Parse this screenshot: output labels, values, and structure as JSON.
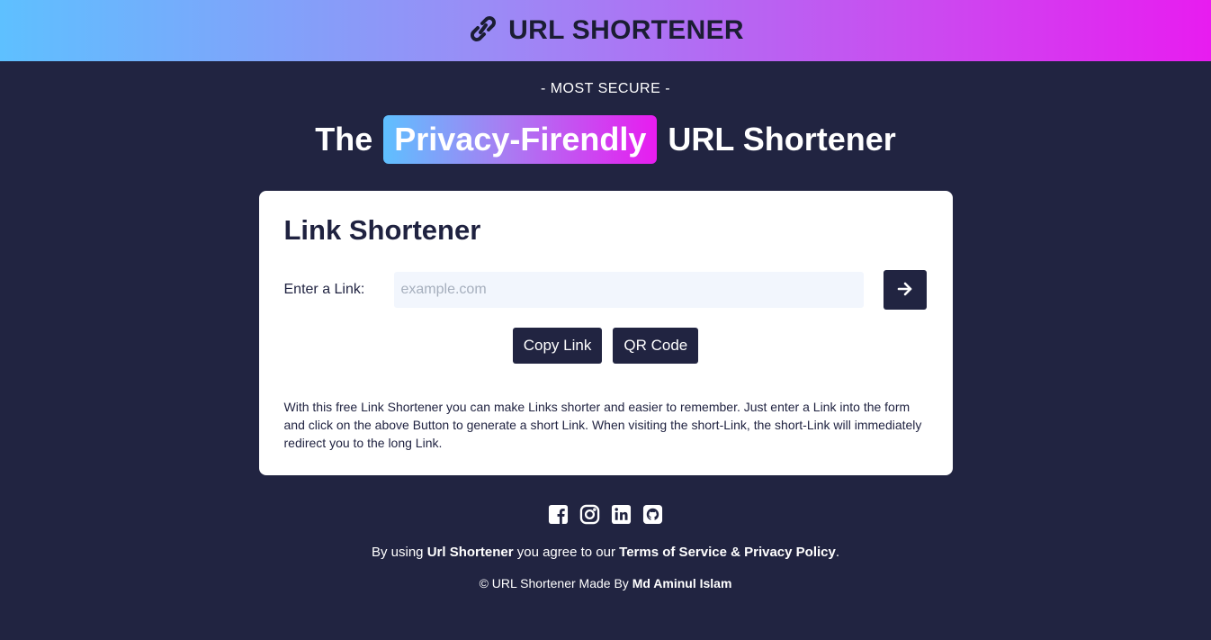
{
  "header": {
    "title": "URL SHORTENER",
    "icon": "link-icon"
  },
  "hero": {
    "tagline": "- MOST SECURE -",
    "headline_pre": "The",
    "headline_highlight": "Privacy-Firendly",
    "headline_post": "URL Shortener"
  },
  "card": {
    "title": "Link Shortener",
    "input_label": "Enter a Link:",
    "input_placeholder": "example.com",
    "input_value": "",
    "submit_icon": "arrow-right-icon",
    "copy_label": "Copy Link",
    "qr_label": "QR Code",
    "description": "With this free Link Shortener you can make Links shorter and easier to remember. Just enter a Link into the form and click on the above Button to generate a short Link. When visiting the short-Link, the short-Link will immediately redirect you to the long Link."
  },
  "footer": {
    "socials": [
      "facebook-icon",
      "instagram-icon",
      "linkedin-icon",
      "github-icon"
    ],
    "agree_pre": "By using",
    "agree_brand": "Url Shortener",
    "agree_mid": "you agree to our",
    "agree_terms": "Terms of Service & Privacy Policy",
    "agree_end": ".",
    "copyright": "© URL Shortener Made By",
    "author": "Md Aminul Islam"
  },
  "colors": {
    "background": "#212441",
    "card": "#ffffff",
    "gradient_start": "#5ec0ff",
    "gradient_end": "#e81cf0",
    "input_bg": "#f2f6fd"
  }
}
